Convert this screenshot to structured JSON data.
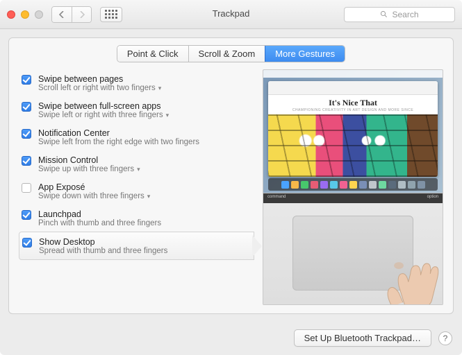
{
  "window": {
    "title": "Trackpad"
  },
  "search": {
    "placeholder": "Search"
  },
  "tabs": [
    {
      "label": "Point & Click",
      "active": false
    },
    {
      "label": "Scroll & Zoom",
      "active": false
    },
    {
      "label": "More Gestures",
      "active": true
    }
  ],
  "options": [
    {
      "title": "Swipe between pages",
      "subtitle": "Scroll left or right with two fingers",
      "checked": true,
      "chevron": true,
      "selected": false
    },
    {
      "title": "Swipe between full-screen apps",
      "subtitle": "Swipe left or right with three fingers",
      "checked": true,
      "chevron": true,
      "selected": false
    },
    {
      "title": "Notification Center",
      "subtitle": "Swipe left from the right edge with two fingers",
      "checked": true,
      "chevron": false,
      "selected": false
    },
    {
      "title": "Mission Control",
      "subtitle": "Swipe up with three fingers",
      "checked": true,
      "chevron": true,
      "selected": false
    },
    {
      "title": "App Exposé",
      "subtitle": "Swipe down with three fingers",
      "checked": false,
      "chevron": true,
      "selected": false
    },
    {
      "title": "Launchpad",
      "subtitle": "Pinch with thumb and three fingers",
      "checked": true,
      "chevron": false,
      "selected": false
    },
    {
      "title": "Show Desktop",
      "subtitle": "Spread with thumb and three fingers",
      "checked": true,
      "chevron": false,
      "selected": true
    }
  ],
  "preview": {
    "site_title": "It's Nice That",
    "site_tag": "CHAMPIONING CREATIVITY IN ART DESIGN AND MORE SINCE",
    "key_left": "command",
    "key_right": "option",
    "dock_colors": [
      "#4aa3ff",
      "#f7b84a",
      "#47c86c",
      "#e85d75",
      "#9a6cf0",
      "#58c8e8",
      "#f06292",
      "#ffd54f",
      "#7a8fb6",
      "#c0c6cc",
      "#6ed9a0",
      "#5a6b7c",
      "#b0bec5",
      "#90a4ae",
      "#7f93a6"
    ]
  },
  "footer": {
    "setup": "Set Up Bluetooth Trackpad…"
  }
}
